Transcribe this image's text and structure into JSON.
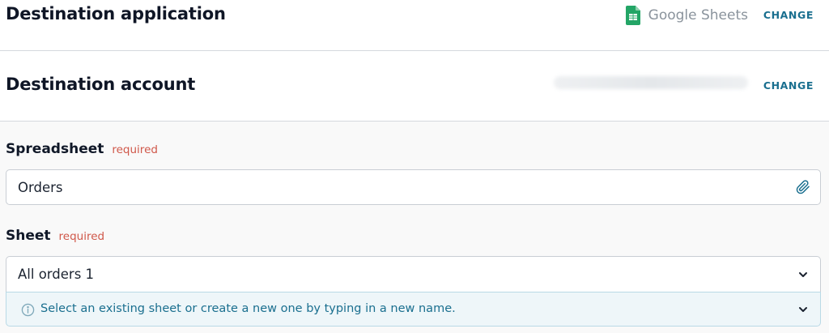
{
  "destination_application": {
    "title": "Destination application",
    "app_name": "Google Sheets",
    "app_icon": "google-sheets-icon",
    "change_label": "CHANGE"
  },
  "destination_account": {
    "title": "Destination account",
    "change_label": "CHANGE"
  },
  "spreadsheet": {
    "label": "Spreadsheet",
    "required_label": "required",
    "value": "Orders",
    "icon": "paperclip-icon"
  },
  "sheet": {
    "label": "Sheet",
    "required_label": "required",
    "selected": "All orders 1",
    "hint": "Select an existing sheet or create a new one by typing in a new name."
  },
  "colors": {
    "link": "#1a6f8f",
    "required": "#d0584a",
    "sheets_green": "#23a566",
    "hint_background": "#eef6f9"
  }
}
